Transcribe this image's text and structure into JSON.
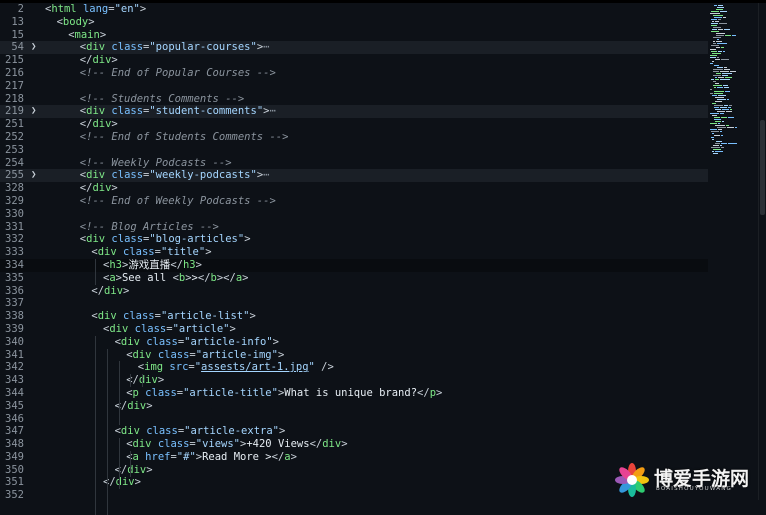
{
  "editor": {
    "lines": [
      {
        "n": "2",
        "fold": false,
        "hl": "",
        "indent": 0,
        "tokens": [
          [
            "punc",
            "<"
          ],
          [
            "tag",
            "html"
          ],
          [
            "punc",
            " "
          ],
          [
            "attr",
            "lang"
          ],
          [
            "punc",
            "="
          ],
          [
            "str",
            "\"en\""
          ],
          [
            "punc",
            ">"
          ]
        ]
      },
      {
        "n": "13",
        "fold": false,
        "hl": "",
        "indent": 1,
        "tokens": [
          [
            "punc",
            "<"
          ],
          [
            "tag",
            "body"
          ],
          [
            "punc",
            ">"
          ]
        ]
      },
      {
        "n": "15",
        "fold": false,
        "hl": "",
        "indent": 2,
        "tokens": [
          [
            "punc",
            "<"
          ],
          [
            "tag",
            "main"
          ],
          [
            "punc",
            ">"
          ]
        ]
      },
      {
        "n": "54",
        "fold": true,
        "hl": "fold",
        "indent": 3,
        "tokens": [
          [
            "punc",
            "<"
          ],
          [
            "tag",
            "div"
          ],
          [
            "punc",
            " "
          ],
          [
            "attr",
            "class"
          ],
          [
            "punc",
            "="
          ],
          [
            "str",
            "\"popular-courses\""
          ],
          [
            "punc",
            ">"
          ],
          [
            "ell",
            "⋯"
          ]
        ]
      },
      {
        "n": "215",
        "fold": false,
        "hl": "",
        "indent": 3,
        "tokens": [
          [
            "punc",
            "</"
          ],
          [
            "tag",
            "div"
          ],
          [
            "punc",
            ">"
          ]
        ]
      },
      {
        "n": "216",
        "fold": false,
        "hl": "",
        "indent": 3,
        "tokens": [
          [
            "com",
            "<!-- End of Popular Courses -->"
          ]
        ]
      },
      {
        "n": "217",
        "fold": false,
        "hl": "",
        "indent": 0,
        "tokens": []
      },
      {
        "n": "218",
        "fold": false,
        "hl": "",
        "indent": 3,
        "tokens": [
          [
            "com",
            "<!-- Students Comments -->"
          ]
        ]
      },
      {
        "n": "219",
        "fold": true,
        "hl": "fold",
        "indent": 3,
        "tokens": [
          [
            "punc",
            "<"
          ],
          [
            "tag",
            "div"
          ],
          [
            "punc",
            " "
          ],
          [
            "attr",
            "class"
          ],
          [
            "punc",
            "="
          ],
          [
            "str",
            "\"student-comments\""
          ],
          [
            "punc",
            ">"
          ],
          [
            "ell",
            "⋯"
          ]
        ]
      },
      {
        "n": "251",
        "fold": false,
        "hl": "",
        "indent": 3,
        "tokens": [
          [
            "punc",
            "</"
          ],
          [
            "tag",
            "div"
          ],
          [
            "punc",
            ">"
          ]
        ]
      },
      {
        "n": "252",
        "fold": false,
        "hl": "",
        "indent": 3,
        "tokens": [
          [
            "com",
            "<!-- End of Students Comments -->"
          ]
        ]
      },
      {
        "n": "253",
        "fold": false,
        "hl": "",
        "indent": 0,
        "tokens": []
      },
      {
        "n": "254",
        "fold": false,
        "hl": "",
        "indent": 3,
        "tokens": [
          [
            "com",
            "<!-- Weekly Podcasts -->"
          ]
        ]
      },
      {
        "n": "255",
        "fold": true,
        "hl": "fold",
        "indent": 3,
        "tokens": [
          [
            "punc",
            "<"
          ],
          [
            "tag",
            "div"
          ],
          [
            "punc",
            " "
          ],
          [
            "attr",
            "class"
          ],
          [
            "punc",
            "="
          ],
          [
            "str",
            "\"weekly-podcasts\""
          ],
          [
            "punc",
            ">"
          ],
          [
            "ell",
            "⋯"
          ]
        ]
      },
      {
        "n": "328",
        "fold": false,
        "hl": "",
        "indent": 3,
        "tokens": [
          [
            "punc",
            "</"
          ],
          [
            "tag",
            "div"
          ],
          [
            "punc",
            ">"
          ]
        ]
      },
      {
        "n": "329",
        "fold": false,
        "hl": "",
        "indent": 3,
        "tokens": [
          [
            "com",
            "<!-- End of Weekly Podcasts -->"
          ]
        ]
      },
      {
        "n": "330",
        "fold": false,
        "hl": "",
        "indent": 0,
        "tokens": []
      },
      {
        "n": "331",
        "fold": false,
        "hl": "",
        "indent": 3,
        "tokens": [
          [
            "com",
            "<!-- Blog Articles -->"
          ]
        ]
      },
      {
        "n": "332",
        "fold": false,
        "hl": "",
        "indent": 3,
        "tokens": [
          [
            "punc",
            "<"
          ],
          [
            "tag",
            "div"
          ],
          [
            "punc",
            " "
          ],
          [
            "attr",
            "class"
          ],
          [
            "punc",
            "="
          ],
          [
            "str",
            "\"blog-articles\""
          ],
          [
            "punc",
            ">"
          ]
        ]
      },
      {
        "n": "333",
        "fold": false,
        "hl": "",
        "indent": 4,
        "tokens": [
          [
            "punc",
            "<"
          ],
          [
            "tag",
            "div"
          ],
          [
            "punc",
            " "
          ],
          [
            "attr",
            "class"
          ],
          [
            "punc",
            "="
          ],
          [
            "str",
            "\"title\""
          ],
          [
            "punc",
            ">"
          ]
        ]
      },
      {
        "n": "334",
        "fold": false,
        "hl": "cur",
        "indent": 5,
        "tokens": [
          [
            "punc",
            "<"
          ],
          [
            "tag",
            "h3"
          ],
          [
            "punc",
            ">"
          ],
          [
            "txt",
            "游戏直播"
          ],
          [
            "punc",
            "</"
          ],
          [
            "tag",
            "h3"
          ],
          [
            "punc",
            ">"
          ]
        ]
      },
      {
        "n": "335",
        "fold": false,
        "hl": "",
        "indent": 5,
        "tokens": [
          [
            "punc",
            "<"
          ],
          [
            "tag",
            "a"
          ],
          [
            "punc",
            ">"
          ],
          [
            "txt",
            "See all "
          ],
          [
            "punc",
            "<"
          ],
          [
            "tag",
            "b"
          ],
          [
            "punc",
            ">"
          ],
          [
            "txt",
            ">"
          ],
          [
            "punc",
            "</"
          ],
          [
            "tag",
            "b"
          ],
          [
            "punc",
            "></"
          ],
          [
            "tag",
            "a"
          ],
          [
            "punc",
            ">"
          ]
        ]
      },
      {
        "n": "336",
        "fold": false,
        "hl": "",
        "indent": 4,
        "tokens": [
          [
            "punc",
            "</"
          ],
          [
            "tag",
            "div"
          ],
          [
            "punc",
            ">"
          ]
        ]
      },
      {
        "n": "337",
        "fold": false,
        "hl": "",
        "indent": 0,
        "tokens": []
      },
      {
        "n": "338",
        "fold": false,
        "hl": "",
        "indent": 4,
        "tokens": [
          [
            "punc",
            "<"
          ],
          [
            "tag",
            "div"
          ],
          [
            "punc",
            " "
          ],
          [
            "attr",
            "class"
          ],
          [
            "punc",
            "="
          ],
          [
            "str",
            "\"article-list\""
          ],
          [
            "punc",
            ">"
          ]
        ]
      },
      {
        "n": "339",
        "fold": false,
        "hl": "",
        "indent": 5,
        "tokens": [
          [
            "punc",
            "<"
          ],
          [
            "tag",
            "div"
          ],
          [
            "punc",
            " "
          ],
          [
            "attr",
            "class"
          ],
          [
            "punc",
            "="
          ],
          [
            "str",
            "\"article\""
          ],
          [
            "punc",
            ">"
          ]
        ]
      },
      {
        "n": "340",
        "fold": false,
        "hl": "",
        "indent": 6,
        "tokens": [
          [
            "punc",
            "<"
          ],
          [
            "tag",
            "div"
          ],
          [
            "punc",
            " "
          ],
          [
            "attr",
            "class"
          ],
          [
            "punc",
            "="
          ],
          [
            "str",
            "\"article-info\""
          ],
          [
            "punc",
            ">"
          ]
        ]
      },
      {
        "n": "341",
        "fold": false,
        "hl": "",
        "indent": 7,
        "tokens": [
          [
            "punc",
            "<"
          ],
          [
            "tag",
            "div"
          ],
          [
            "punc",
            " "
          ],
          [
            "attr",
            "class"
          ],
          [
            "punc",
            "="
          ],
          [
            "str",
            "\"article-img\""
          ],
          [
            "punc",
            ">"
          ]
        ]
      },
      {
        "n": "342",
        "fold": false,
        "hl": "",
        "indent": 8,
        "tokens": [
          [
            "punc",
            "<"
          ],
          [
            "tag",
            "img"
          ],
          [
            "punc",
            " "
          ],
          [
            "attr",
            "src"
          ],
          [
            "punc",
            "="
          ],
          [
            "str",
            "\""
          ],
          [
            "strul",
            "assests/art-1.jpg"
          ],
          [
            "str",
            "\""
          ],
          [
            "punc",
            " />"
          ]
        ]
      },
      {
        "n": "343",
        "fold": false,
        "hl": "",
        "indent": 7,
        "tokens": [
          [
            "punc",
            "</"
          ],
          [
            "tag",
            "div"
          ],
          [
            "punc",
            ">"
          ]
        ]
      },
      {
        "n": "344",
        "fold": false,
        "hl": "",
        "indent": 7,
        "tokens": [
          [
            "punc",
            "<"
          ],
          [
            "tag",
            "p"
          ],
          [
            "punc",
            " "
          ],
          [
            "attr",
            "class"
          ],
          [
            "punc",
            "="
          ],
          [
            "str",
            "\"article-title\""
          ],
          [
            "punc",
            ">"
          ],
          [
            "txt",
            "What is unique brand?"
          ],
          [
            "punc",
            "</"
          ],
          [
            "tag",
            "p"
          ],
          [
            "punc",
            ">"
          ]
        ]
      },
      {
        "n": "345",
        "fold": false,
        "hl": "",
        "indent": 6,
        "tokens": [
          [
            "punc",
            "</"
          ],
          [
            "tag",
            "div"
          ],
          [
            "punc",
            ">"
          ]
        ]
      },
      {
        "n": "346",
        "fold": false,
        "hl": "",
        "indent": 0,
        "tokens": []
      },
      {
        "n": "347",
        "fold": false,
        "hl": "",
        "indent": 6,
        "tokens": [
          [
            "punc",
            "<"
          ],
          [
            "tag",
            "div"
          ],
          [
            "punc",
            " "
          ],
          [
            "attr",
            "class"
          ],
          [
            "punc",
            "="
          ],
          [
            "str",
            "\"article-extra\""
          ],
          [
            "punc",
            ">"
          ]
        ]
      },
      {
        "n": "348",
        "fold": false,
        "hl": "",
        "indent": 7,
        "tokens": [
          [
            "punc",
            "<"
          ],
          [
            "tag",
            "div"
          ],
          [
            "punc",
            " "
          ],
          [
            "attr",
            "class"
          ],
          [
            "punc",
            "="
          ],
          [
            "str",
            "\"views\""
          ],
          [
            "punc",
            ">"
          ],
          [
            "txt",
            "+420 Views"
          ],
          [
            "punc",
            "</"
          ],
          [
            "tag",
            "div"
          ],
          [
            "punc",
            ">"
          ]
        ]
      },
      {
        "n": "349",
        "fold": false,
        "hl": "",
        "indent": 7,
        "tokens": [
          [
            "punc",
            "<"
          ],
          [
            "tag",
            "a"
          ],
          [
            "punc",
            " "
          ],
          [
            "attr",
            "href"
          ],
          [
            "punc",
            "="
          ],
          [
            "str",
            "\"#\""
          ],
          [
            "punc",
            ">"
          ],
          [
            "txt",
            "Read More >"
          ],
          [
            "punc",
            "</"
          ],
          [
            "tag",
            "a"
          ],
          [
            "punc",
            ">"
          ]
        ]
      },
      {
        "n": "350",
        "fold": false,
        "hl": "",
        "indent": 6,
        "tokens": [
          [
            "punc",
            "</"
          ],
          [
            "tag",
            "div"
          ],
          [
            "punc",
            ">"
          ]
        ]
      },
      {
        "n": "351",
        "fold": false,
        "hl": "",
        "indent": 5,
        "tokens": [
          [
            "punc",
            "</"
          ],
          [
            "tag",
            "div"
          ],
          [
            "punc",
            ">"
          ]
        ]
      },
      {
        "n": "352",
        "fold": false,
        "hl": "",
        "indent": 0,
        "tokens": []
      }
    ]
  },
  "watermark": {
    "title": "博爱手游网",
    "subtitle": "BOAISHOUYOUWANG"
  },
  "colors": {
    "background": "#0d1117",
    "tag": "#7ee787",
    "attribute": "#79c0ff",
    "string": "#a5d6ff",
    "comment": "#8b949e",
    "text": "#e6edf3"
  }
}
